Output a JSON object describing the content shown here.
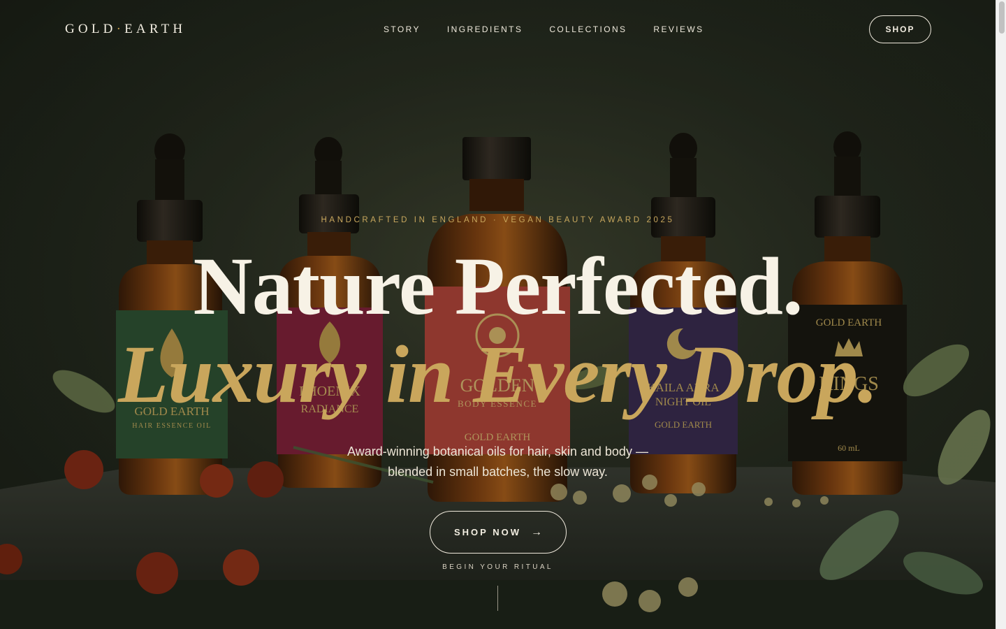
{
  "nav": {
    "brand_left": "GOLD",
    "brand_sep": "·",
    "brand_right": "EARTH",
    "links": [
      "STORY",
      "INGREDIENTS",
      "COLLECTIONS",
      "REVIEWS"
    ],
    "shop_label": "SHOP"
  },
  "hero": {
    "eyebrow": "HANDCRAFTED IN ENGLAND · VEGAN BEAUTY AWARD 2025",
    "headline_line1": "Nature Perfected.",
    "headline_line2": "Luxury in Every Drop.",
    "subcopy_line1": "Award-winning botanical oils for hair, skin and body —",
    "subcopy_line2": "blended in small batches, the slow way.",
    "cta_label": "SHOP NOW",
    "cta_icon": "arrow-right-icon",
    "cta_arrow": "→",
    "cta_caption": "BEGIN YOUR RITUAL"
  },
  "background": {
    "description_icon": "product-bottles-image",
    "labels": [
      {
        "line1": "GOLD EARTH",
        "line2": "HAIR ESSENCE OIL"
      },
      {
        "line1": "PHOENIX",
        "line2": "RADIANCE"
      },
      {
        "line1": "GOLDEN",
        "line2": "BODY ESSENCE"
      },
      {
        "line1": "KAILA AURA",
        "line2": "NIGHT OIL"
      },
      {
        "line1": "GOLD EARTH",
        "line2": "KINGS",
        "line3": "60 mL"
      }
    ]
  },
  "colors": {
    "accent_gold": "#c9a65c",
    "text_cream": "#f3eee2",
    "background_dark": "#1a1f17"
  }
}
